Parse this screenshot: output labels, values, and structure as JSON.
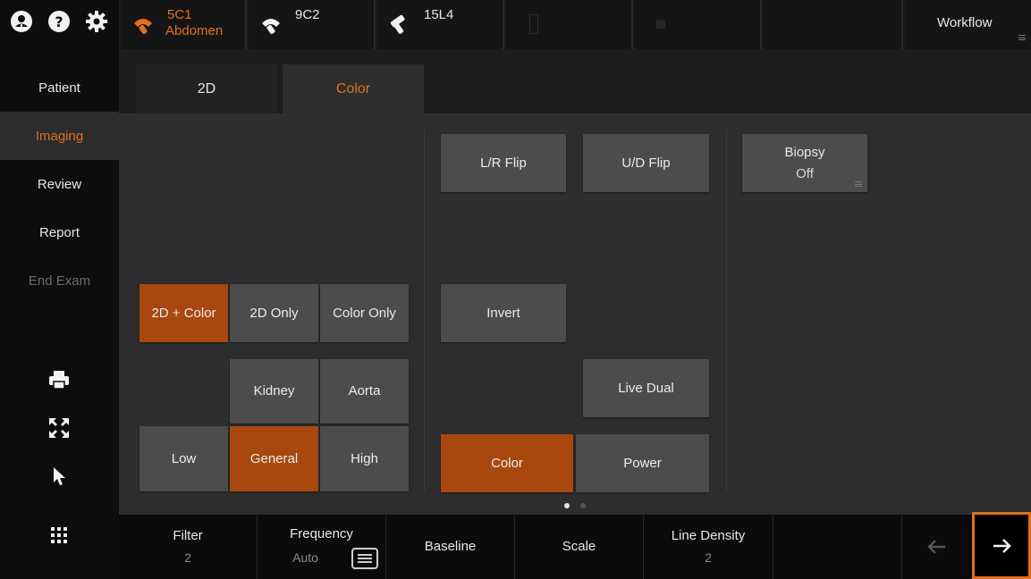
{
  "topbar": {
    "icons": [
      "user-icon",
      "help-icon",
      "settings-icon"
    ],
    "probes": [
      {
        "label": "5C1",
        "sub": "Abdomen",
        "active": true
      },
      {
        "label": "9C2",
        "sub": "",
        "active": false
      },
      {
        "label": "15L4",
        "sub": "",
        "active": false
      }
    ],
    "workflow_label": "Workflow"
  },
  "sidebar": {
    "items": [
      {
        "label": "Patient",
        "state": "normal"
      },
      {
        "label": "Imaging",
        "state": "active"
      },
      {
        "label": "Review",
        "state": "normal"
      },
      {
        "label": "Report",
        "state": "normal"
      },
      {
        "label": "End Exam",
        "state": "disabled"
      }
    ],
    "tools": [
      "print-icon",
      "fullscreen-icon",
      "pointer-icon",
      "apps-grid-icon"
    ]
  },
  "subtabs": [
    {
      "label": "2D",
      "active": false
    },
    {
      "label": "Color",
      "active": true
    }
  ],
  "panel": {
    "mode_buttons": [
      "2D + Color",
      "2D Only",
      "Color Only"
    ],
    "preset_buttons": [
      "Kidney",
      "Aorta"
    ],
    "level_buttons": [
      "Low",
      "General",
      "High"
    ],
    "lr_flip": "L/R Flip",
    "ud_flip": "U/D Flip",
    "biopsy": {
      "label": "Biopsy",
      "value": "Off"
    },
    "invert": "Invert",
    "live_dual": "Live Dual",
    "color_mode_buttons": [
      "Color",
      "Power"
    ],
    "page_dots": {
      "count": 2,
      "active_index": 0
    }
  },
  "bottombar": {
    "controls": [
      {
        "label": "Filter",
        "value": "2"
      },
      {
        "label": "Frequency",
        "value": "Auto"
      },
      {
        "label": "Baseline",
        "value": ""
      },
      {
        "label": "Scale",
        "value": ""
      },
      {
        "label": "Line Density",
        "value": "2"
      }
    ]
  },
  "colors": {
    "accent": "#e07020",
    "button_active": "#a8480e",
    "button": "#4c4c4c",
    "panel": "#2e2e2e",
    "background": "#0d0d0d"
  }
}
